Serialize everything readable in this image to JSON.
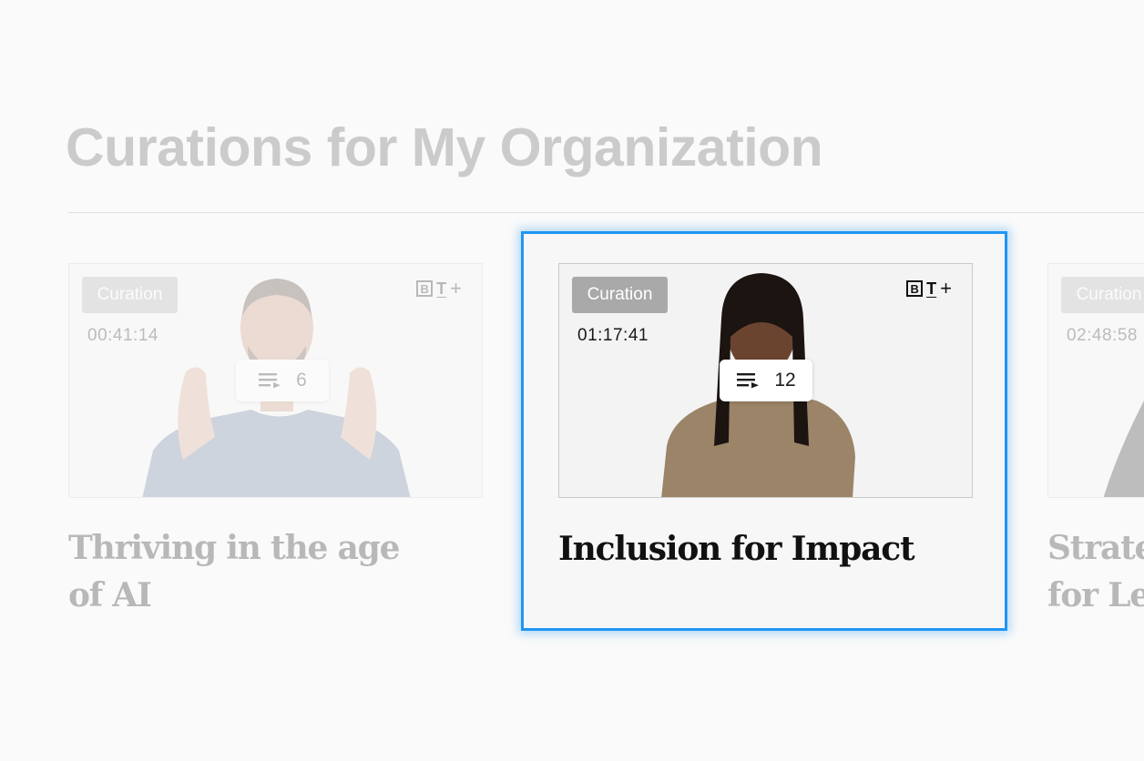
{
  "section": {
    "title": "Curations for My Organization"
  },
  "cards": [
    {
      "chip": "Curation",
      "duration": "00:41:14",
      "item_count": "6",
      "title_lines": [
        "Thriving in the age",
        "of AI"
      ],
      "state": "dimmed"
    },
    {
      "chip": "Curation",
      "duration": "01:17:41",
      "item_count": "12",
      "title_lines": [
        "Inclusion for Impact"
      ],
      "state": "focused"
    },
    {
      "chip": "Curation",
      "duration": "02:48:58",
      "title_lines": [
        "Strate",
        "for Le"
      ],
      "state": "dimmed, partially cut off"
    }
  ],
  "brand": {
    "logo_b": "B",
    "logo_t": "T",
    "logo_plus": "+"
  },
  "icons": {
    "playlist": "playlist-icon"
  },
  "colors": {
    "focus_ring": "#2196f3",
    "chip_bg": "#a9a9a9",
    "title_text": "#111111",
    "faded_text": "#cbcbcb"
  }
}
